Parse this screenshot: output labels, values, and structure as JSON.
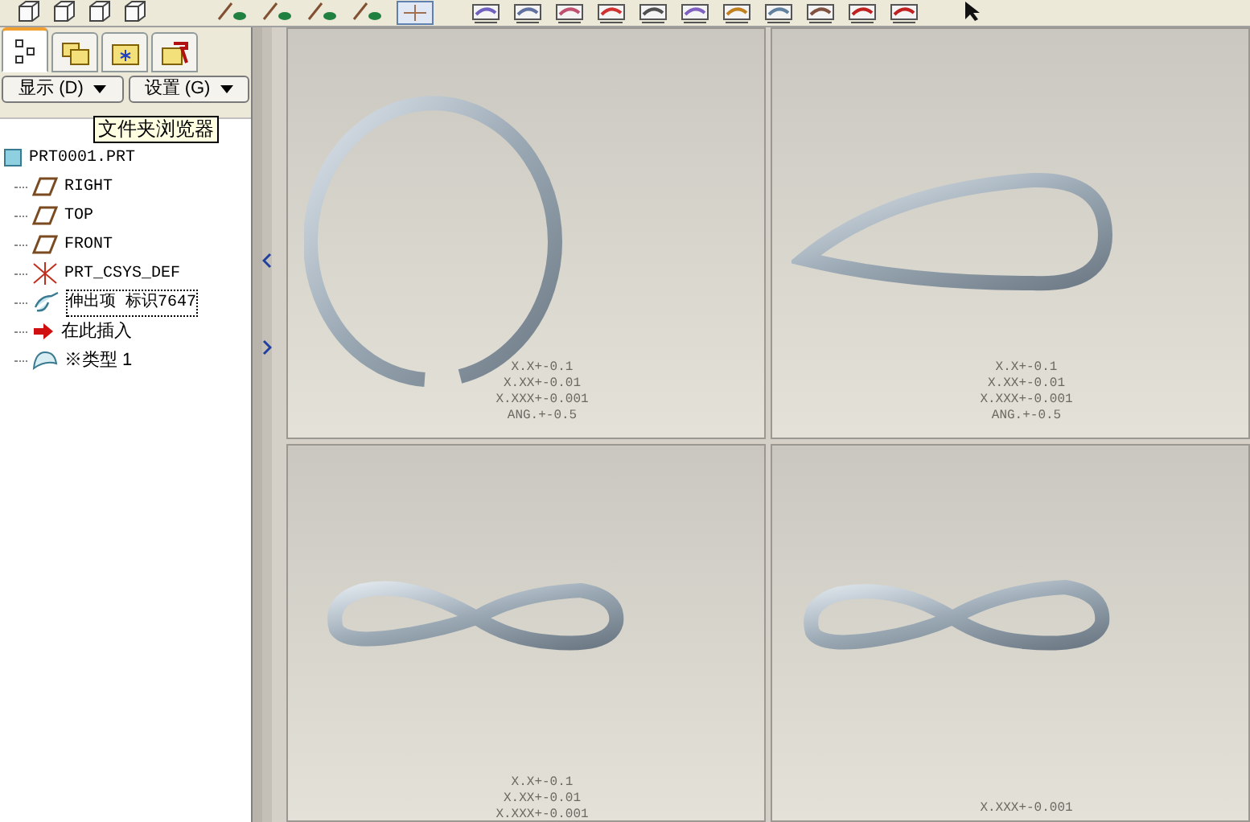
{
  "navigator_tabs": [
    {
      "kind": "tree",
      "selected": true
    },
    {
      "kind": "layers",
      "selected": false
    },
    {
      "kind": "folder",
      "selected": false
    },
    {
      "kind": "favorites",
      "selected": false
    }
  ],
  "dropdowns": [
    {
      "label": "显示 (D)"
    },
    {
      "label": "设置 (G)"
    }
  ],
  "tooltip": "文件夹浏览器",
  "model_tree": {
    "label": "PRT0001.PRT",
    "kind": "part",
    "children": [
      {
        "label": "RIGHT",
        "kind": "plane"
      },
      {
        "label": "TOP",
        "kind": "plane"
      },
      {
        "label": "FRONT",
        "kind": "plane"
      },
      {
        "label": "PRT_CSYS_DEF",
        "kind": "csys"
      },
      {
        "label": "伸出项 标识7647",
        "kind": "sweep",
        "selected": true
      },
      {
        "label": "在此插入",
        "kind": "insert",
        "selected": false
      },
      {
        "label": "※类型 1",
        "kind": "feature",
        "selected": false
      }
    ]
  },
  "viewports": [
    {
      "kind": "ring",
      "tolerances": [
        "X.X+-0.1",
        "X.XX+-0.01",
        "X.XXX+-0.001",
        "ANG.+-0.5"
      ]
    },
    {
      "kind": "teardrop",
      "tolerances": [
        "X.X+-0.1",
        "X.XX+-0.01",
        "X.XXX+-0.001",
        "ANG.+-0.5"
      ]
    },
    {
      "kind": "figure8",
      "tolerances": [
        "X.X+-0.1",
        "X.XX+-0.01",
        "X.XXX+-0.001"
      ]
    },
    {
      "kind": "figure8b",
      "tolerances": [
        "X.XXX+-0.001"
      ]
    }
  ]
}
